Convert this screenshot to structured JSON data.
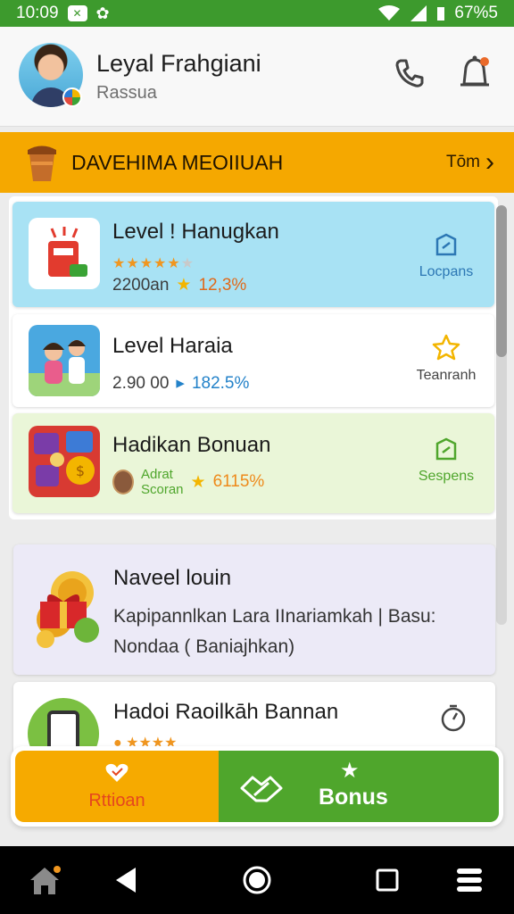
{
  "status_bar": {
    "time": "10:09",
    "battery": "67%5"
  },
  "header": {
    "title": "Leyal Frahgiani",
    "subtitle": "Rassua"
  },
  "banner": {
    "title": "DAVEHIMA MEOIIUAH",
    "link": "Tōm"
  },
  "games": [
    {
      "title": "Level ! Hanugkan",
      "count": "2200an",
      "percent": "12,3%",
      "action": "Locpans"
    },
    {
      "title": "Level Haraia",
      "count": "2.90 00",
      "percent": "182.5%",
      "action": "Teanranh"
    },
    {
      "title": "Hadikan Bonuan",
      "badge_line1": "Adrat",
      "badge_line2": "Scoran",
      "percent": "6115%",
      "action": "Sespens"
    }
  ],
  "info_card": {
    "title": "Naveel louin",
    "body": "Kapipannlkan Lara IInariamkah | Basu: Nondaa ( Baniajhkan)"
  },
  "bottom_card": {
    "title": "Hadoi Raoilkāh Bannan"
  },
  "tabs": {
    "action_label": "Rttioan",
    "bonus_label": "Bonus"
  },
  "colors": {
    "status_green": "#3d9a2d",
    "banner_orange": "#f5a800",
    "card_blue": "#a8e2f4",
    "card_green": "#eaf6d8",
    "bonus_green": "#4fa62c",
    "info_lavender": "#eceaf7"
  },
  "icons": [
    "phone-icon",
    "bell-icon",
    "cup-icon",
    "chevron-right-icon",
    "edit-square-icon",
    "star-outline-icon",
    "timer-icon",
    "heart-icon",
    "handshake-icon",
    "star-icon",
    "home-icon",
    "back-icon",
    "circle-home-icon",
    "recents-icon",
    "menu-icon"
  ]
}
